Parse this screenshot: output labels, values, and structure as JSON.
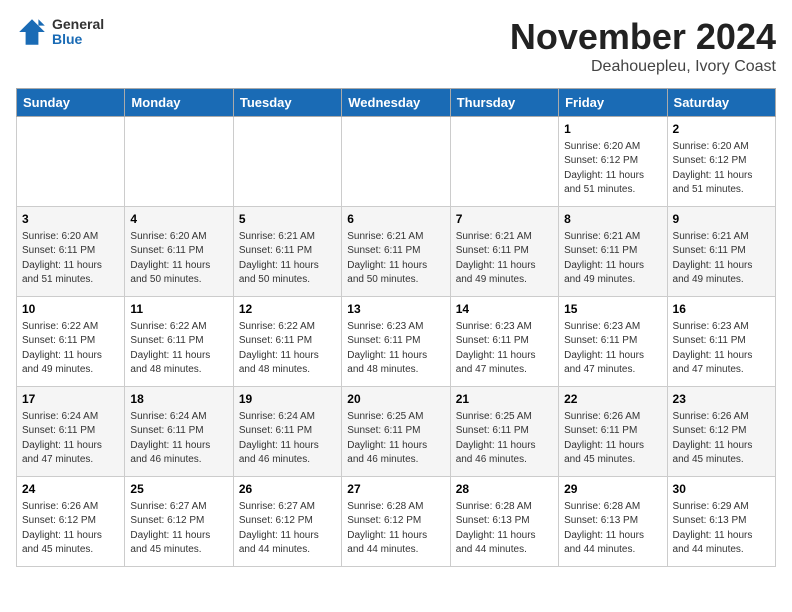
{
  "logo": {
    "general": "General",
    "blue": "Blue"
  },
  "title": "November 2024",
  "location": "Deahouepleu, Ivory Coast",
  "days_of_week": [
    "Sunday",
    "Monday",
    "Tuesday",
    "Wednesday",
    "Thursday",
    "Friday",
    "Saturday"
  ],
  "weeks": [
    [
      {
        "day": "",
        "info": ""
      },
      {
        "day": "",
        "info": ""
      },
      {
        "day": "",
        "info": ""
      },
      {
        "day": "",
        "info": ""
      },
      {
        "day": "",
        "info": ""
      },
      {
        "day": "1",
        "info": "Sunrise: 6:20 AM\nSunset: 6:12 PM\nDaylight: 11 hours and 51 minutes."
      },
      {
        "day": "2",
        "info": "Sunrise: 6:20 AM\nSunset: 6:12 PM\nDaylight: 11 hours and 51 minutes."
      }
    ],
    [
      {
        "day": "3",
        "info": "Sunrise: 6:20 AM\nSunset: 6:11 PM\nDaylight: 11 hours and 51 minutes."
      },
      {
        "day": "4",
        "info": "Sunrise: 6:20 AM\nSunset: 6:11 PM\nDaylight: 11 hours and 50 minutes."
      },
      {
        "day": "5",
        "info": "Sunrise: 6:21 AM\nSunset: 6:11 PM\nDaylight: 11 hours and 50 minutes."
      },
      {
        "day": "6",
        "info": "Sunrise: 6:21 AM\nSunset: 6:11 PM\nDaylight: 11 hours and 50 minutes."
      },
      {
        "day": "7",
        "info": "Sunrise: 6:21 AM\nSunset: 6:11 PM\nDaylight: 11 hours and 49 minutes."
      },
      {
        "day": "8",
        "info": "Sunrise: 6:21 AM\nSunset: 6:11 PM\nDaylight: 11 hours and 49 minutes."
      },
      {
        "day": "9",
        "info": "Sunrise: 6:21 AM\nSunset: 6:11 PM\nDaylight: 11 hours and 49 minutes."
      }
    ],
    [
      {
        "day": "10",
        "info": "Sunrise: 6:22 AM\nSunset: 6:11 PM\nDaylight: 11 hours and 49 minutes."
      },
      {
        "day": "11",
        "info": "Sunrise: 6:22 AM\nSunset: 6:11 PM\nDaylight: 11 hours and 48 minutes."
      },
      {
        "day": "12",
        "info": "Sunrise: 6:22 AM\nSunset: 6:11 PM\nDaylight: 11 hours and 48 minutes."
      },
      {
        "day": "13",
        "info": "Sunrise: 6:23 AM\nSunset: 6:11 PM\nDaylight: 11 hours and 48 minutes."
      },
      {
        "day": "14",
        "info": "Sunrise: 6:23 AM\nSunset: 6:11 PM\nDaylight: 11 hours and 47 minutes."
      },
      {
        "day": "15",
        "info": "Sunrise: 6:23 AM\nSunset: 6:11 PM\nDaylight: 11 hours and 47 minutes."
      },
      {
        "day": "16",
        "info": "Sunrise: 6:23 AM\nSunset: 6:11 PM\nDaylight: 11 hours and 47 minutes."
      }
    ],
    [
      {
        "day": "17",
        "info": "Sunrise: 6:24 AM\nSunset: 6:11 PM\nDaylight: 11 hours and 47 minutes."
      },
      {
        "day": "18",
        "info": "Sunrise: 6:24 AM\nSunset: 6:11 PM\nDaylight: 11 hours and 46 minutes."
      },
      {
        "day": "19",
        "info": "Sunrise: 6:24 AM\nSunset: 6:11 PM\nDaylight: 11 hours and 46 minutes."
      },
      {
        "day": "20",
        "info": "Sunrise: 6:25 AM\nSunset: 6:11 PM\nDaylight: 11 hours and 46 minutes."
      },
      {
        "day": "21",
        "info": "Sunrise: 6:25 AM\nSunset: 6:11 PM\nDaylight: 11 hours and 46 minutes."
      },
      {
        "day": "22",
        "info": "Sunrise: 6:26 AM\nSunset: 6:11 PM\nDaylight: 11 hours and 45 minutes."
      },
      {
        "day": "23",
        "info": "Sunrise: 6:26 AM\nSunset: 6:12 PM\nDaylight: 11 hours and 45 minutes."
      }
    ],
    [
      {
        "day": "24",
        "info": "Sunrise: 6:26 AM\nSunset: 6:12 PM\nDaylight: 11 hours and 45 minutes."
      },
      {
        "day": "25",
        "info": "Sunrise: 6:27 AM\nSunset: 6:12 PM\nDaylight: 11 hours and 45 minutes."
      },
      {
        "day": "26",
        "info": "Sunrise: 6:27 AM\nSunset: 6:12 PM\nDaylight: 11 hours and 44 minutes."
      },
      {
        "day": "27",
        "info": "Sunrise: 6:28 AM\nSunset: 6:12 PM\nDaylight: 11 hours and 44 minutes."
      },
      {
        "day": "28",
        "info": "Sunrise: 6:28 AM\nSunset: 6:13 PM\nDaylight: 11 hours and 44 minutes."
      },
      {
        "day": "29",
        "info": "Sunrise: 6:28 AM\nSunset: 6:13 PM\nDaylight: 11 hours and 44 minutes."
      },
      {
        "day": "30",
        "info": "Sunrise: 6:29 AM\nSunset: 6:13 PM\nDaylight: 11 hours and 44 minutes."
      }
    ]
  ]
}
